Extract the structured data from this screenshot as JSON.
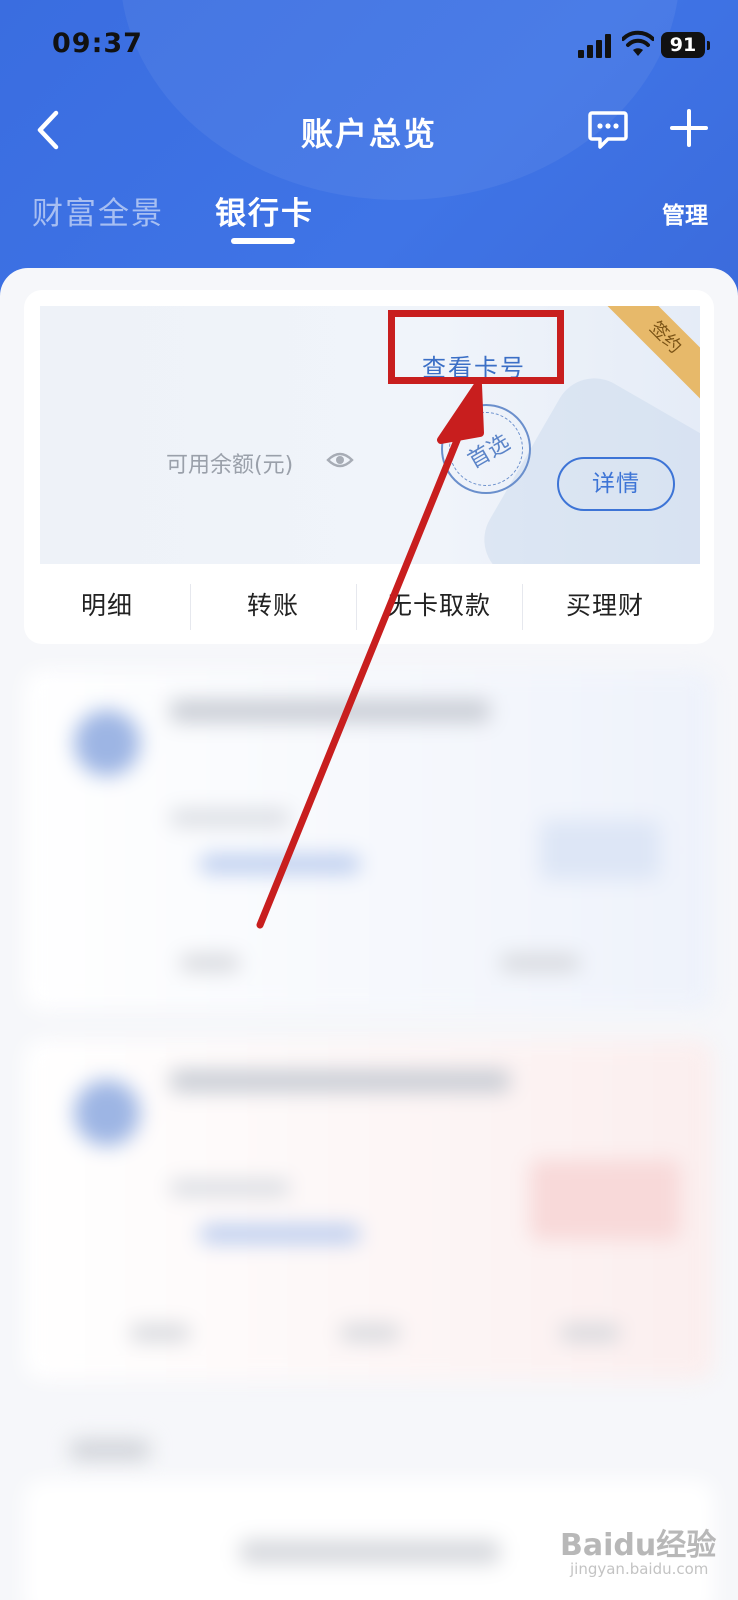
{
  "status_bar": {
    "time": "09:37",
    "battery": "91"
  },
  "nav": {
    "title": "账户总览"
  },
  "tabs": [
    {
      "label": "财富全景",
      "active": false
    },
    {
      "label": "银行卡",
      "active": true
    }
  ],
  "manage_label": "管理",
  "card": {
    "signed_badge": "签约",
    "view_card_number": "查看卡号",
    "balance_label": "可用余额(元)",
    "preferred_stamp": "首选",
    "detail_button": "详情",
    "actions": [
      "明细",
      "转账",
      "无卡取款",
      "买理财"
    ]
  },
  "watermark": {
    "brand": "Baidu经验",
    "site": "jingyan.baidu.com"
  },
  "colors": {
    "header_blue": "#3f74e6",
    "accent_blue": "#3d74d6",
    "annotation_red": "#c81e1e",
    "signed_gold": "#e7b96a"
  }
}
